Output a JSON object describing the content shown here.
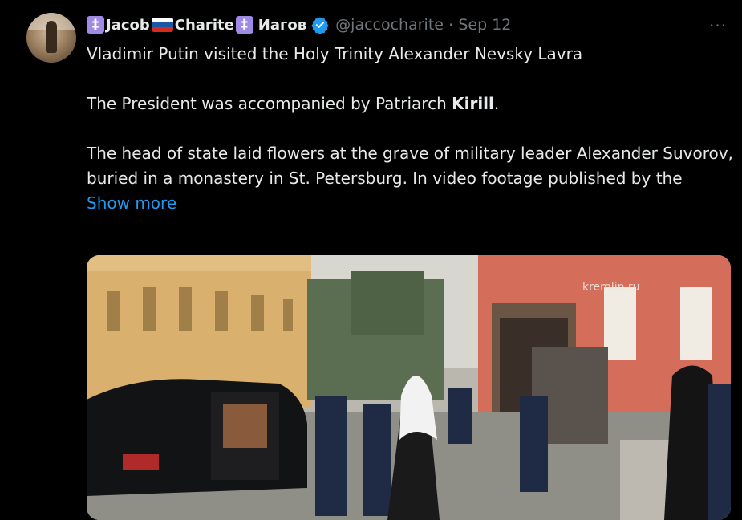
{
  "author": {
    "cross_glyph": "‡",
    "name_part_1": "Jacob",
    "name_part_2": "Charite",
    "name_part_3": "Иагов",
    "handle": "@jaccocharite",
    "date": "Sep 12",
    "flag_colors": [
      "#ffffff",
      "#1c57a5",
      "#d52b1e"
    ],
    "cross_color": "#9f8be6",
    "verified_color": "#1d9bf0"
  },
  "tweet": {
    "line_1": "Vladimir Putin visited the Holy Trinity Alexander Nevsky Lavra",
    "line_2_prefix": "The President was accompanied by Patriarch ",
    "line_2_bold": "Kirill",
    "line_2_suffix": ".",
    "line_3": "The head of state laid flowers at the grave of military leader Alexander Suvorov, buried in a monastery in St. Petersburg. In video footage published by the",
    "show_more": "Show more"
  },
  "media": {
    "watermark": "kremlin.ru"
  },
  "icons": {
    "more_glyph": "···"
  }
}
